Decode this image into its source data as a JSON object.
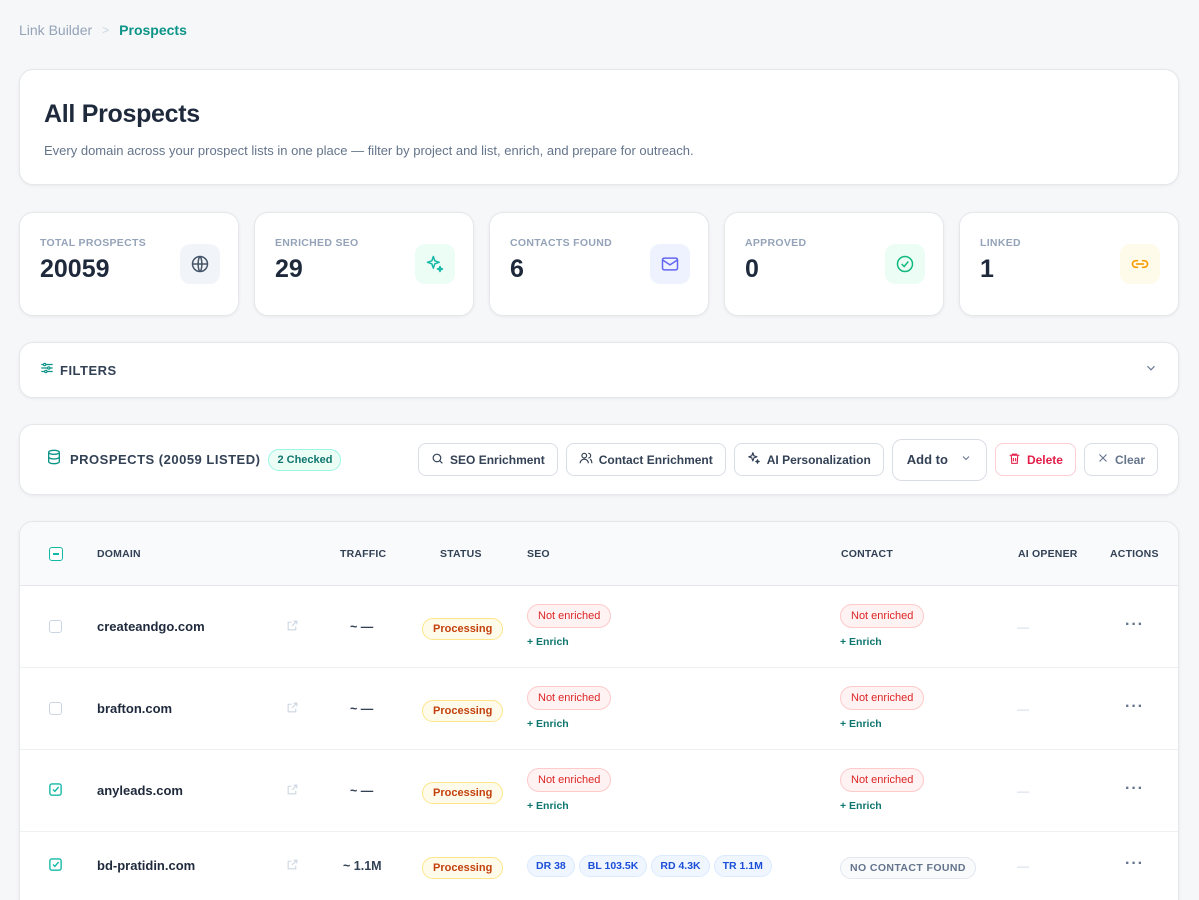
{
  "breadcrumb": {
    "parent": "Link Builder",
    "current": "Prospects"
  },
  "hero": {
    "title": "All Prospects",
    "subtitle": "Every domain across your prospect lists in one place — filter by project and list, enrich, and prepare for outreach."
  },
  "stats": [
    {
      "label": "TOTAL PROSPECTS",
      "value": "20059",
      "icon": "globe-icon",
      "color": "#475569",
      "bg": "#f1f5f9"
    },
    {
      "label": "ENRICHED SEO",
      "value": "29",
      "icon": "sparkles-icon",
      "color": "#14b8a6",
      "bg": "#ecfdf5"
    },
    {
      "label": "CONTACTS FOUND",
      "value": "6",
      "icon": "mail-icon",
      "color": "#6366f1",
      "bg": "#eef2ff"
    },
    {
      "label": "APPROVED",
      "value": "0",
      "icon": "check-circle-icon",
      "color": "#10b981",
      "bg": "#ecfdf5"
    },
    {
      "label": "LINKED",
      "value": "1",
      "icon": "link-icon",
      "color": "#f59e0b",
      "bg": "#fffbeb"
    }
  ],
  "filters": {
    "label": "FILTERS"
  },
  "toolbar": {
    "title": "PROSPECTS (20059 LISTED)",
    "checked": "2 Checked",
    "seo_enrichment": "SEO Enrichment",
    "contact_enrichment": "Contact Enrichment",
    "ai_personalization": "AI Personalization",
    "add_to": "Add to",
    "delete": "Delete",
    "clear": "Clear"
  },
  "table": {
    "columns": {
      "domain": "DOMAIN",
      "traffic": "TRAFFIC",
      "status": "STATUS",
      "seo": "SEO",
      "contact": "CONTACT",
      "ai_opener": "AI OPENER",
      "actions": "ACTIONS"
    },
    "rows": [
      {
        "domain": "createandgo.com",
        "checked": false,
        "traffic": "~ —",
        "status": "Processing",
        "seo": "Not enriched",
        "seo_action": "+ Enrich",
        "contact": "Not enriched",
        "contact_action": "+ Enrich",
        "ai_opener": "—",
        "actions": "···"
      },
      {
        "domain": "brafton.com",
        "checked": false,
        "traffic": "~ —",
        "status": "Processing",
        "seo": "Not enriched",
        "seo_action": "+ Enrich",
        "contact": "Not enriched",
        "contact_action": "+ Enrich",
        "ai_opener": "—",
        "actions": "···"
      },
      {
        "domain": "anyleads.com",
        "checked": true,
        "traffic": "~ —",
        "status": "Processing",
        "seo": "Not enriched",
        "seo_action": "+ Enrich",
        "contact": "Not enriched",
        "contact_action": "+ Enrich",
        "ai_opener": "—",
        "actions": "···"
      },
      {
        "domain": "bd-pratidin.com",
        "checked": true,
        "traffic": "~ 1.1M",
        "status": "Processing",
        "seo_pills": [
          "DR 38",
          "BL 103.5K",
          "RD 4.3K",
          "TR 1.1M"
        ],
        "contact": "NO CONTACT FOUND",
        "ai_opener": "—",
        "actions": "···"
      }
    ]
  }
}
